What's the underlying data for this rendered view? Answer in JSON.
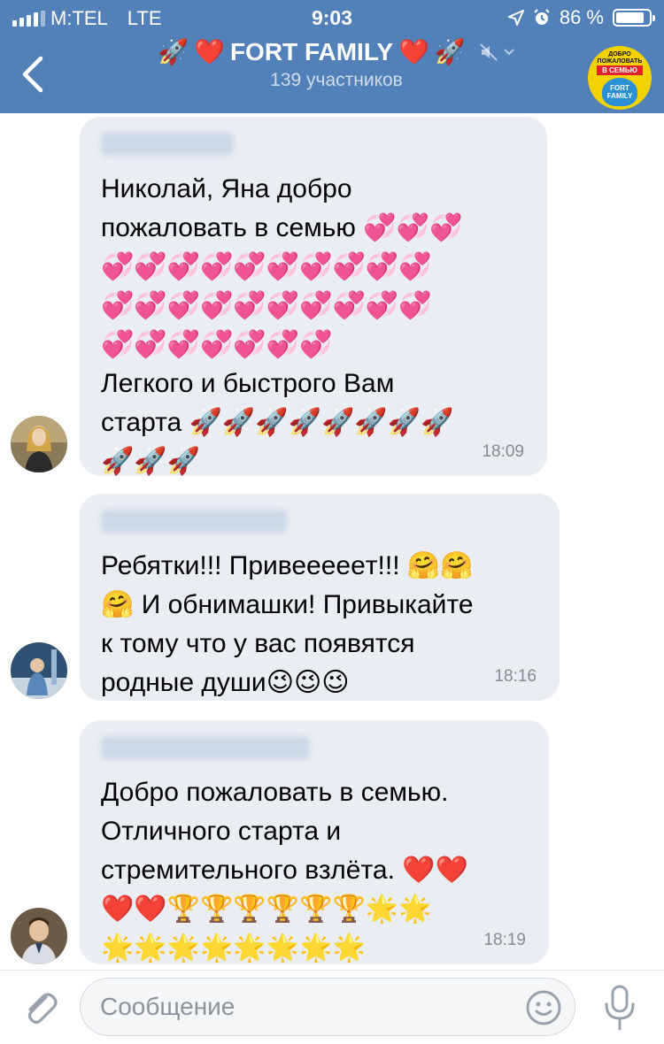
{
  "status_bar": {
    "carrier": "M:TEL",
    "network": "LTE",
    "time": "9:03",
    "battery": "86 %",
    "battery_level": 0.86
  },
  "header": {
    "title": "FORT FAMILY",
    "subtitle": "139 участников",
    "avatar_text_top": "ДОБРО ПОЖАЛОВАТЬ",
    "avatar_text_band": "В СЕМЬЮ",
    "avatar_text_globe": "FORT FAMILY"
  },
  "messages": [
    {
      "text": "Николай, Яна добро\nпожаловать в семью 💞💞💞\n💞💞💞💞💞💞💞💞💞💞\n💞💞💞💞💞💞💞💞💞💞\n💞💞💞💞💞💞💞\nЛегкого и быстрого Вам\nстарта 🚀🚀🚀🚀🚀🚀🚀🚀\n🚀🚀🚀",
      "time": "18:09"
    },
    {
      "text": "Ребятки!!! Привеееeeт!!! 🤗🤗\n🤗 И обнимашки! Привыкайте\nк тому что у вас появятся\nродные души😉😉😉",
      "time": "18:16"
    },
    {
      "text": "Добро пожаловать в семью.\nОтличного старта и\nстремительного взлёта. ❤️❤️\n❤️❤️🏆🏆🏆🏆🏆🏆🌟🌟\n🌟🌟🌟🌟🌟🌟🌟🌟",
      "time": "18:19"
    }
  ],
  "composer": {
    "placeholder": "Сообщение"
  },
  "colors": {
    "header": "#5181b8",
    "bubble": "#eaedf1",
    "time": "#828b96"
  }
}
